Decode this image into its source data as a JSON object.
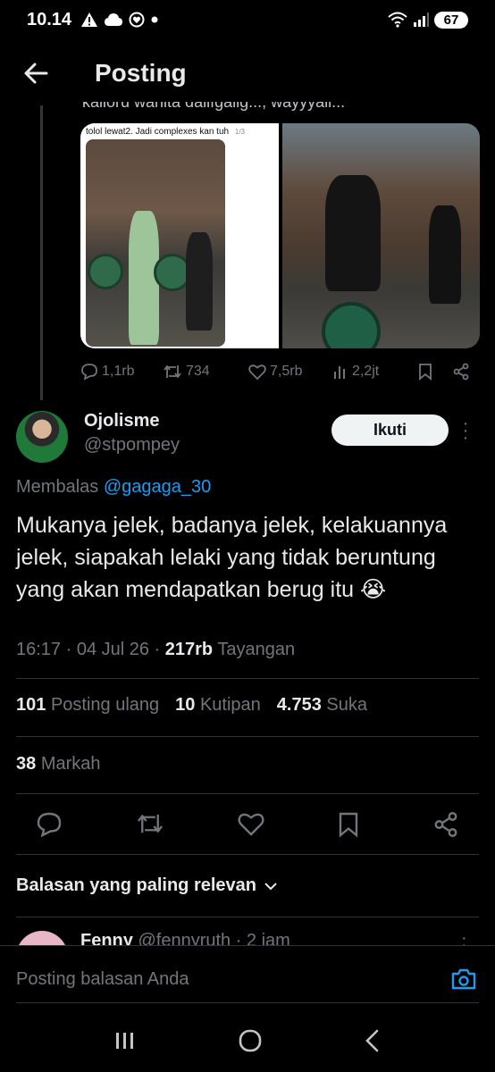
{
  "status_bar": {
    "time": "10.14",
    "battery": "67",
    "icons_left": [
      "warning-icon",
      "cloud-icon",
      "notification-icon",
      "dot-icon"
    ],
    "icons_right": [
      "wifi-icon",
      "signal-icon",
      "battery-icon"
    ]
  },
  "header": {
    "title": "Posting",
    "back_icon": "back-arrow-icon"
  },
  "parent_post": {
    "cut_text": "kalloru wahita dalifgallg..., wayyyall...",
    "media": {
      "left_caption": "tolol lewat2. Jadi complexes kan tuh",
      "left_page": "1/3"
    },
    "actions": {
      "replies": "1,1rb",
      "reposts": "734",
      "likes": "7,5rb",
      "views": "2,2jt"
    }
  },
  "reply": {
    "name": "Ojolisme",
    "handle": "@stpompey",
    "follow_label": "Ikuti",
    "replying_prefix": "Membalas",
    "replying_to": "@gagaga_30",
    "text": "Mukanya jelek, badanya jelek, kelakuannya jelek, siapakah lelaki yang tidak beruntung yang akan mendapatkan berug itu 😭",
    "time": "16:17 · 04 Jul 26 · ",
    "views_count": "217rb",
    "views_label": " Tayangan",
    "stats": {
      "reposts_count": "101",
      "reposts_label": "Posting ulang",
      "quotes_count": "10",
      "quotes_label": "Kutipan",
      "likes_count": "4.753",
      "likes_label": "Suka",
      "bookmarks_count": "38",
      "bookmarks_label": "Markah"
    }
  },
  "relevant_label": "Balasan yang paling relevan",
  "next_reply": {
    "name": "Fenny",
    "meta": " @fennyruth · 2 jam"
  },
  "compose": {
    "placeholder": "Posting balasan Anda"
  },
  "colors": {
    "background": "#000000",
    "text": "#e7e9ea",
    "muted": "#71767b",
    "link": "#1d9bf0",
    "divider": "#2f3336"
  }
}
